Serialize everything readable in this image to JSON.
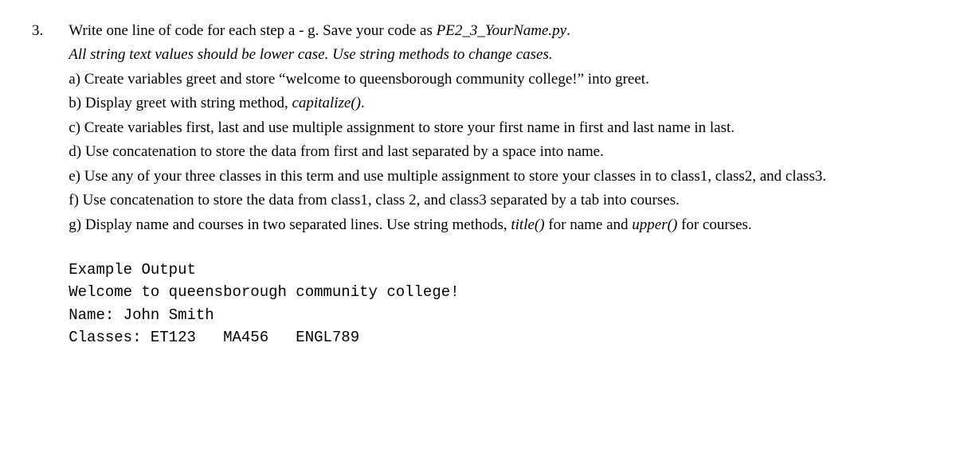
{
  "question_number": "3.",
  "instruction": {
    "line1_part1": "Write one line of code for each step a - g.  Save your code as ",
    "line1_italic": "PE2_3_YourName.py",
    "line1_part2": ".",
    "line2_italic": "All string text values should be lower case.   Use string methods to change cases."
  },
  "steps": {
    "a": "a) Create variables greet and store “welcome to queensborough community college!” into greet.",
    "b_part1": "b) Display greet with string method, ",
    "b_italic": "capitalize()",
    "b_part2": ".",
    "c": "c) Create variables first, last and use multiple assignment to store your first name in first and last name in last.",
    "d": "d) Use concatenation to store the data from first and last separated by a space into name.",
    "e": "e) Use any of your three classes in this term and use multiple assignment to store your classes in to class1, class2, and class3.",
    "f": "f) Use concatenation to store the data from class1, class 2, and class3 separated by a tab into courses.",
    "g_part1": "g) Display name and courses in two separated lines. Use string methods, ",
    "g_italic1": "title()",
    "g_part2": " for name and ",
    "g_italic2": "upper()",
    "g_part3": " for courses."
  },
  "example": {
    "header": "Example Output",
    "line1": "Welcome to queensborough community college!",
    "line2": "Name: John Smith",
    "line3": "Classes: ET123   MA456   ENGL789"
  }
}
